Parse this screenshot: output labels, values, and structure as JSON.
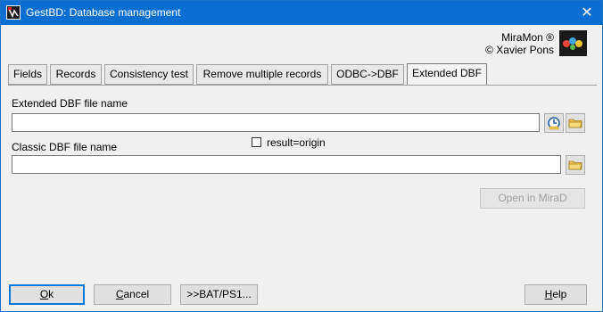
{
  "window": {
    "title": "GestBD: Database management",
    "close_glyph": "✕"
  },
  "brand": {
    "line1": "MiraMon ®",
    "line2": "© Xavier Pons"
  },
  "tabs": [
    {
      "label": "Fields"
    },
    {
      "label": "Records"
    },
    {
      "label": "Consistency test"
    },
    {
      "label": "Remove multiple records"
    },
    {
      "label": "ODBC->DBF"
    },
    {
      "label": "Extended DBF",
      "active": true
    }
  ],
  "form": {
    "extended_label": "Extended DBF file name",
    "extended_value": "",
    "classic_label": "Classic DBF file name",
    "classic_value": "",
    "result_origin_label": "result=origin",
    "result_origin_checked": false,
    "open_miraD_label": "Open in MiraD"
  },
  "buttons": {
    "ok": {
      "underline": "O",
      "rest": "k"
    },
    "cancel": {
      "underline": "C",
      "rest": "ancel"
    },
    "bat": ">>BAT/PS1...",
    "help": {
      "underline": "H",
      "rest": "elp"
    }
  },
  "icons": [
    "app-icon",
    "close-icon",
    "miramon-logo",
    "clock-icon",
    "folder-icon",
    "checkbox"
  ],
  "colors": {
    "titlebar": "#0a6fd1",
    "default_button_border": "#0078d7",
    "folder_yellow": "#f0c850"
  }
}
